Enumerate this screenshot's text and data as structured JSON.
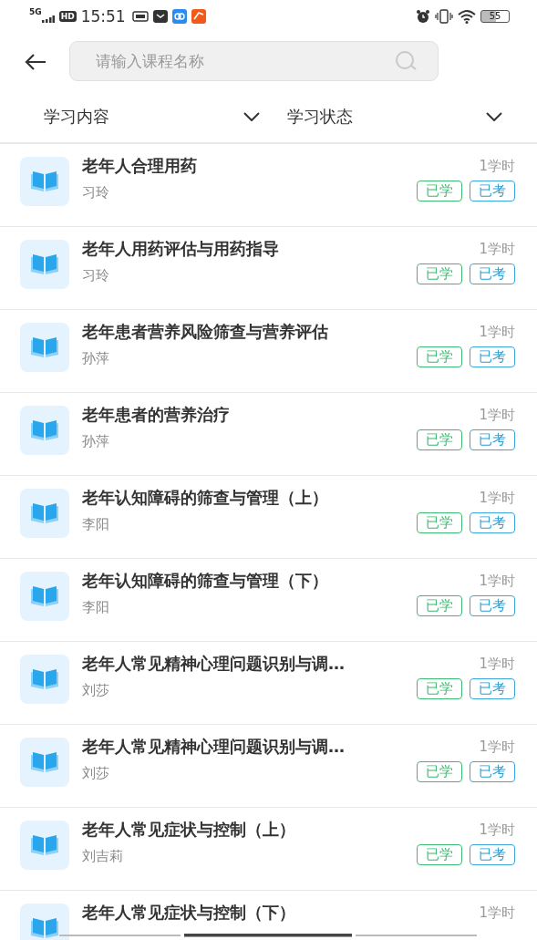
{
  "status_bar": {
    "network": "5G",
    "hd": "HD",
    "time": "15:51",
    "battery": "55"
  },
  "search": {
    "placeholder": "请输入课程名称"
  },
  "filters": [
    {
      "label": "学习内容"
    },
    {
      "label": "学习状态"
    }
  ],
  "courses": [
    {
      "title": "老年人合理用药",
      "author": "习玲",
      "hours": "1学时",
      "badges": [
        {
          "kind": "studied",
          "label": "已学"
        },
        {
          "kind": "examined",
          "label": "已考"
        }
      ]
    },
    {
      "title": "老年人用药评估与用药指导",
      "author": "习玲",
      "hours": "1学时",
      "badges": [
        {
          "kind": "studied",
          "label": "已学"
        },
        {
          "kind": "examined",
          "label": "已考"
        }
      ]
    },
    {
      "title": "老年患者营养风险筛查与营养评估",
      "author": "孙萍",
      "hours": "1学时",
      "badges": [
        {
          "kind": "studied",
          "label": "已学"
        },
        {
          "kind": "examined",
          "label": "已考"
        }
      ]
    },
    {
      "title": "老年患者的营养治疗",
      "author": "孙萍",
      "hours": "1学时",
      "badges": [
        {
          "kind": "studied",
          "label": "已学"
        },
        {
          "kind": "examined",
          "label": "已考"
        }
      ]
    },
    {
      "title": "老年认知障碍的筛查与管理（上）",
      "author": "李阳",
      "hours": "1学时",
      "badges": [
        {
          "kind": "studied",
          "label": "已学"
        },
        {
          "kind": "examined",
          "label": "已考"
        }
      ]
    },
    {
      "title": "老年认知障碍的筛查与管理（下）",
      "author": "李阳",
      "hours": "1学时",
      "badges": [
        {
          "kind": "studied",
          "label": "已学"
        },
        {
          "kind": "examined",
          "label": "已考"
        }
      ]
    },
    {
      "title": "老年人常见精神心理问题识别与调…",
      "author": "刘莎",
      "hours": "1学时",
      "badges": [
        {
          "kind": "studied",
          "label": "已学"
        },
        {
          "kind": "examined",
          "label": "已考"
        }
      ]
    },
    {
      "title": "老年人常见精神心理问题识别与调…",
      "author": "刘莎",
      "hours": "1学时",
      "badges": [
        {
          "kind": "studied",
          "label": "已学"
        },
        {
          "kind": "examined",
          "label": "已考"
        }
      ]
    },
    {
      "title": "老年人常见症状与控制（上）",
      "author": "刘吉莉",
      "hours": "1学时",
      "badges": [
        {
          "kind": "studied",
          "label": "已学"
        },
        {
          "kind": "examined",
          "label": "已考"
        }
      ]
    },
    {
      "title": "老年人常见症状与控制（下）",
      "hours": "1学时"
    }
  ]
}
